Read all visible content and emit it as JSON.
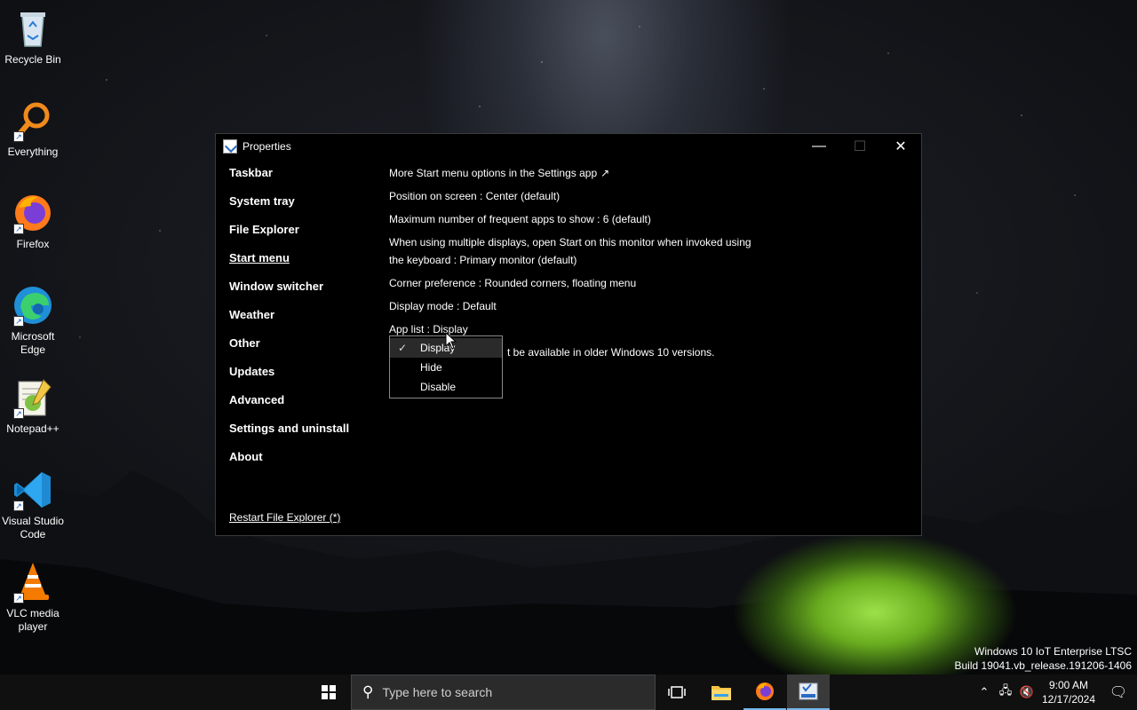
{
  "desktop": {
    "icons": [
      {
        "label": "Recycle Bin",
        "icon": "recycle-bin-icon"
      },
      {
        "label": "Everything",
        "icon": "everything-search-icon"
      },
      {
        "label": "Firefox",
        "icon": "firefox-icon"
      },
      {
        "label": "Microsoft Edge",
        "icon": "edge-icon"
      },
      {
        "label": "Notepad++",
        "icon": "notepadpp-icon"
      },
      {
        "label": "Visual Studio Code",
        "icon": "vscode-icon"
      },
      {
        "label": "VLC media player",
        "icon": "vlc-icon"
      }
    ],
    "build_line1": "Windows 10 IoT Enterprise LTSC",
    "build_line2": "Build 19041.vb_release.191206-1406"
  },
  "window": {
    "title": "Properties",
    "minimize": "—",
    "maximize": "☐",
    "close": "✕",
    "sidebar": [
      "Taskbar",
      "System tray",
      "File Explorer",
      "Start menu",
      "Window switcher",
      "Weather",
      "Other",
      "Updates",
      "Advanced",
      "Settings and uninstall",
      "About"
    ],
    "active_item": "Start menu",
    "restart_link": "Restart File Explorer (*)",
    "settings": {
      "more_options": "More Start menu options in the Settings app",
      "more_options_arrow": "↗",
      "position": "Position on screen : Center (default)",
      "max_frequent": "Maximum number of frequent apps to show : 6 (default)",
      "multi_display": "When using multiple displays, open Start on this monitor when invoked using the keyboard : Primary monitor (default)",
      "corner": "Corner preference : Rounded corners, floating menu",
      "display_mode": "Display mode : Default",
      "app_list": "App list : Display",
      "partial_note": "t be available in older Windows 10 versions."
    },
    "dropdown": {
      "options": [
        "Display",
        "Hide",
        "Disable"
      ],
      "selected": "Display",
      "check": "✓"
    }
  },
  "taskbar": {
    "search_placeholder": "Type here to search",
    "clock_time": "9:00 AM",
    "clock_date": "12/17/2024"
  },
  "colors": {
    "accent": "#76b9ed",
    "window_bg": "#000000",
    "taskbar_bg": "#101010"
  }
}
